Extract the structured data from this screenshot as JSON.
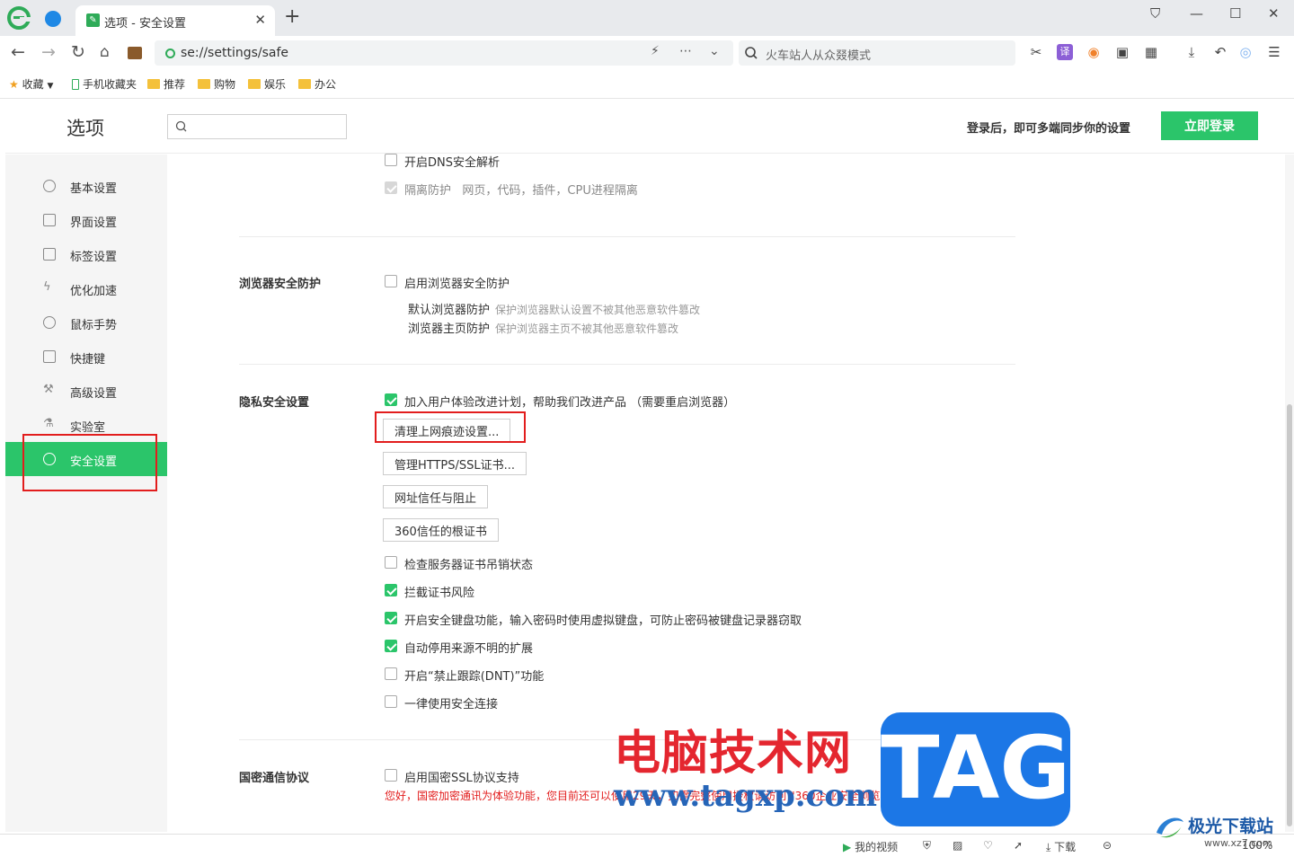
{
  "browser": {
    "tab": {
      "title": "选项 - 安全设置"
    },
    "url": "se://settings/safe",
    "search_placeholder": "火车站人从众叕模式"
  },
  "bookmarks": [
    {
      "label": "收藏"
    },
    {
      "label": "手机收藏夹"
    },
    {
      "label": "推荐"
    },
    {
      "label": "购物"
    },
    {
      "label": "娱乐"
    },
    {
      "label": "办公"
    }
  ],
  "header": {
    "title": "选项",
    "sync_text": "登录后，即可多端同步你的设置",
    "login_button": "立即登录"
  },
  "sidebar": {
    "items": [
      {
        "label": "基本设置",
        "icon": "gear-icon"
      },
      {
        "label": "界面设置",
        "icon": "layout-icon"
      },
      {
        "label": "标签设置",
        "icon": "tab-icon"
      },
      {
        "label": "优化加速",
        "icon": "lightning-icon"
      },
      {
        "label": "鼠标手势",
        "icon": "mouse-icon"
      },
      {
        "label": "快捷键",
        "icon": "keyboard-icon"
      },
      {
        "label": "高级设置",
        "icon": "wrench-icon"
      },
      {
        "label": "实验室",
        "icon": "flask-icon"
      },
      {
        "label": "安全设置",
        "icon": "shield-icon",
        "active": true
      }
    ]
  },
  "main": {
    "top_options": [
      {
        "label": "开启DNS安全解析",
        "checked": false
      },
      {
        "label": "隔离防护",
        "detail": "网页，代码，插件，CPU进程隔离",
        "checked": true,
        "disabled": true
      }
    ],
    "browser_protection": {
      "title": "浏览器安全防护",
      "option": {
        "label": "启用浏览器安全防护",
        "checked": false
      },
      "subs": [
        {
          "label": "默认浏览器防护",
          "desc": "保护浏览器默认设置不被其他恶意软件篡改"
        },
        {
          "label": "浏览器主页防护",
          "desc": "保护浏览器主页不被其他恶意软件篡改"
        }
      ]
    },
    "privacy": {
      "title": "隐私安全设置",
      "join": {
        "label": "加入用户体验改进计划，帮助我们改进产品 （需要重启浏览器）",
        "checked": true
      },
      "buttons": {
        "clear": "清理上网痕迹设置...",
        "https": "管理HTTPS/SSL证书...",
        "trust": "网址信任与阻止",
        "root": "360信任的根证书"
      },
      "options": [
        {
          "label": "检查服务器证书吊销状态",
          "checked": false
        },
        {
          "label": "拦截证书风险",
          "checked": true
        },
        {
          "label": "开启安全键盘功能，输入密码时使用虚拟键盘，可防止密码被键盘记录器窃取",
          "checked": true
        },
        {
          "label": "自动停用来源不明的扩展",
          "checked": true
        },
        {
          "label": "开启“禁止跟踪(DNT)”功能",
          "checked": false
        },
        {
          "label": "一律使用安全连接",
          "checked": false
        }
      ]
    },
    "gm": {
      "title": "国密通信协议",
      "option": {
        "label": "启用国密SSL协议支持",
        "checked": false
      },
      "warning": "您好，国密加密通讯为体验功能，您目前还可以使用29天，如需完整使用授权请访问 \"360企业安全浏览器官网"
    }
  },
  "statusbar": {
    "video": "我的视频",
    "download": "下载",
    "zoom": "100%"
  },
  "watermark": {
    "cn": "电脑技术网",
    "tag": "TAG",
    "url": "www.tagxp.com",
    "site": "极光下载站",
    "site_url": "www.xz7.com"
  },
  "colors": {
    "accent": "#2bc56a",
    "highlight_box": "#e21d1d"
  }
}
